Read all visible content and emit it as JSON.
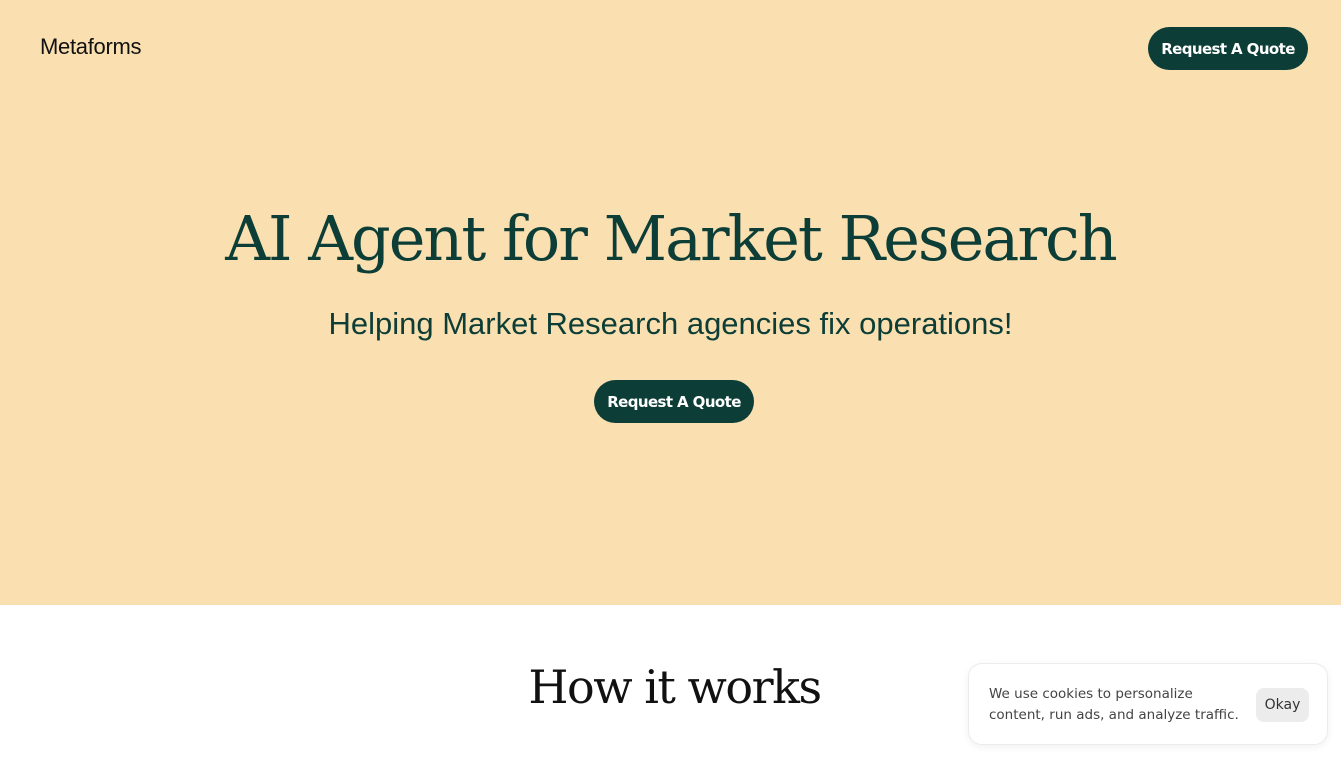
{
  "header": {
    "brand": "Metaforms",
    "cta_label": "Request A Quote"
  },
  "hero": {
    "title": "AI Agent for Market Research",
    "subtitle": "Helping Market Research agencies fix operations!",
    "cta_label": "Request A Quote"
  },
  "how_it_works": {
    "title": "How it works"
  },
  "cookie_banner": {
    "message": "We use cookies to personalize content, run ads, and analyze traffic.",
    "accept_label": "Okay"
  },
  "colors": {
    "hero_background": "#fadfb0",
    "accent": "#0c3d36",
    "page_background": "#ffffff"
  }
}
